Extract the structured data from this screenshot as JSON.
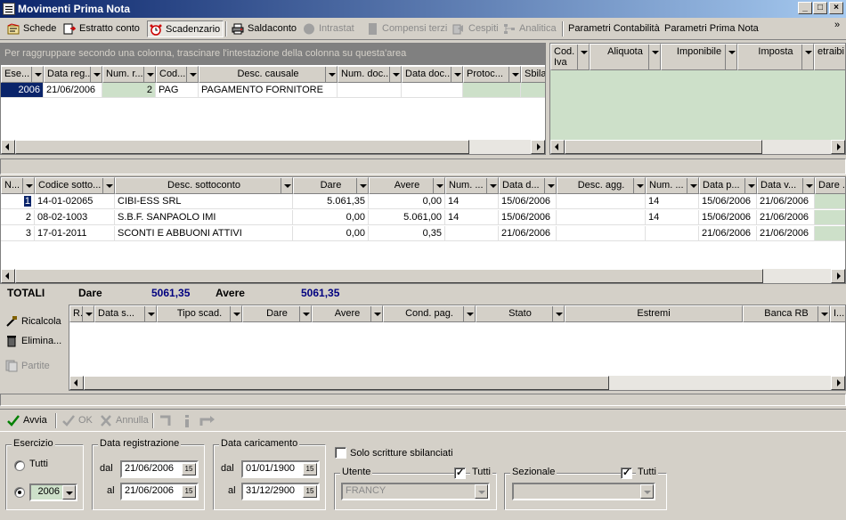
{
  "window": {
    "title": "Movimenti Prima Nota"
  },
  "toolbar": {
    "schede": "Schede",
    "estratto_conto": "Estratto conto",
    "scadenzario": "Scadenzario",
    "saldaconto": "Saldaconto",
    "intrastat": "Intrastat",
    "compensi_terzi": "Compensi terzi",
    "cespiti": "Cespiti",
    "analitica": "Analitica",
    "parametri_contabilita": "Parametri Contabilità",
    "parametri_prima_nota": "Parametri Prima Nota"
  },
  "main_grid": {
    "group_hint": "Per raggruppare secondo una colonna, trascinare l'intestazione della colonna su questa'area",
    "columns": [
      "Ese...",
      "Data reg...",
      "Num. r...",
      "Cod...",
      "Desc. causale",
      "Num. doc...",
      "Data doc...",
      "Protoc...",
      "Sbilan"
    ],
    "rows": [
      {
        "ese": "2006",
        "data_reg": "21/06/2006",
        "num_r": "2",
        "cod": "PAG",
        "desc": "PAGAMENTO FORNITORE",
        "num_doc": "",
        "data_doc": "",
        "protoc": "",
        "sbil": ""
      }
    ]
  },
  "iva_grid": {
    "columns": [
      "Cod. Iva",
      "Aliquota",
      "Imponibile",
      "Imposta",
      "etraibi"
    ]
  },
  "detail_grid": {
    "columns": [
      "N...",
      "Codice sotto...",
      "Desc. sottoconto",
      "Dare",
      "Avere",
      "Num. ...",
      "Data d...",
      "Desc. agg.",
      "Num. ...",
      "Data p...",
      "Data v...",
      "Dare ..."
    ],
    "rows": [
      {
        "n": "1",
        "codice": "14-01-02065",
        "desc": "CIBI-ESS SRL",
        "dare": "5.061,35",
        "avere": "0,00",
        "num1": "14",
        "data_d": "15/06/2006",
        "desc_agg": "",
        "num2": "14",
        "data_p": "15/06/2006",
        "data_v": "21/06/2006"
      },
      {
        "n": "2",
        "codice": "08-02-1003",
        "desc": "S.B.F. SANPAOLO IMI",
        "dare": "0,00",
        "avere": "5.061,00",
        "num1": "14",
        "data_d": "15/06/2006",
        "desc_agg": "",
        "num2": "14",
        "data_p": "15/06/2006",
        "data_v": "21/06/2006"
      },
      {
        "n": "3",
        "codice": "17-01-2011",
        "desc": "SCONTI E ABBUONI ATTIVI",
        "dare": "0,00",
        "avere": "0,35",
        "num1": "",
        "data_d": "21/06/2006",
        "desc_agg": "",
        "num2": "",
        "data_p": "21/06/2006",
        "data_v": "21/06/2006"
      }
    ]
  },
  "totals": {
    "label": "TOTALI",
    "dare_label": "Dare",
    "dare_value": "5061,35",
    "avere_label": "Avere",
    "avere_value": "5061,35"
  },
  "scad_side": {
    "ricalcola": "Ricalcola",
    "elimina": "Elimina...",
    "partite": "Partite"
  },
  "scad_grid": {
    "columns": [
      "R...",
      "Data s...",
      "Tipo scad.",
      "Dare",
      "Avere",
      "Cond. pag.",
      "Stato",
      "Estremi",
      "Banca RB",
      "I..."
    ]
  },
  "actions": {
    "avvia": "Avvia",
    "ok": "OK",
    "annulla": "Annulla"
  },
  "filters": {
    "esercizio_label": "Esercizio",
    "tutti_label": "Tutti",
    "esercizio_value": "2006",
    "data_reg_label": "Data registrazione",
    "dal_label": "dal",
    "al_label": "al",
    "data_reg_dal": "21/06/2006",
    "data_reg_al": "21/06/2006",
    "data_car_label": "Data caricamento",
    "data_car_dal": "01/01/1900",
    "data_car_al": "31/12/2900",
    "solo_sbilanciati": "Solo scritture sbilanciati",
    "utente_label": "Utente",
    "utente_tutti": "Tutti",
    "utente_value": "FRANCY",
    "sezionale_label": "Sezionale",
    "sezionale_tutti": "Tutti",
    "sezionale_value": "",
    "cal_icon_text": "15"
  },
  "colors": {
    "selected_row": "#0a246a",
    "green_cell": "#cde0c9",
    "totals_blue": "#000080"
  }
}
